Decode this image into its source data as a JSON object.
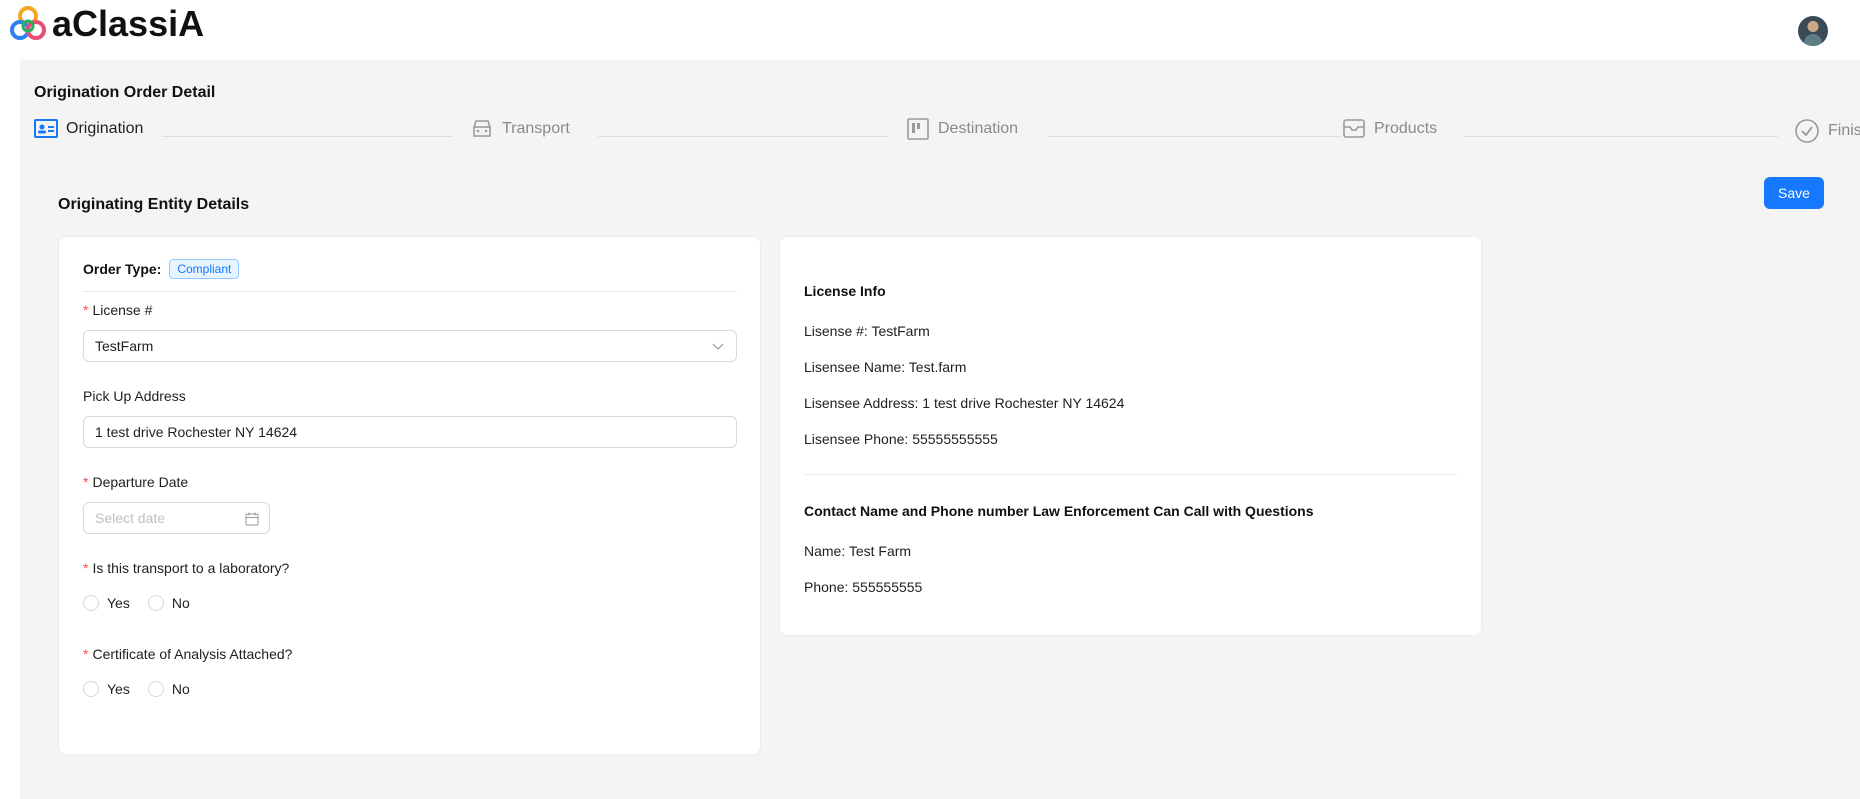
{
  "header": {
    "brand": "aClassiA",
    "logo_icon": "interlocking-rings-logo",
    "avatar_icon": "user-avatar"
  },
  "page": {
    "title": "Origination Order Detail",
    "section_title": "Originating Entity Details",
    "save_label": "Save"
  },
  "steps": [
    {
      "label": "Origination",
      "icon": "id-card-icon",
      "active": true
    },
    {
      "label": "Transport",
      "icon": "truck-icon",
      "active": false
    },
    {
      "label": "Destination",
      "icon": "board-icon",
      "active": false
    },
    {
      "label": "Products",
      "icon": "inbox-icon",
      "active": false
    },
    {
      "label": "Finish",
      "icon": "check-circle-icon",
      "active": false
    }
  ],
  "form": {
    "order_type_label": "Order Type:",
    "order_type_value": "Compliant",
    "license_label": "License #",
    "license_value": "TestFarm",
    "pickup_label": "Pick Up Address",
    "pickup_value": "1 test drive Rochester NY 14624",
    "departure_label": "Departure Date",
    "departure_placeholder": "Select date",
    "lab_question": "Is this transport to a laboratory?",
    "coa_question": "Certificate of Analysis Attached?",
    "yes_label": "Yes",
    "no_label": "No"
  },
  "license_info": {
    "title": "License Info",
    "license_line": "Lisense #: TestFarm",
    "name_line": "Lisensee Name: Test.farm",
    "address_line": "Lisensee Address: 1 test drive Rochester NY 14624",
    "phone_line": "Lisensee Phone: 55555555555",
    "contact_title": "Contact Name and Phone number Law Enforcement Can Call with Questions",
    "contact_name_line": "Name: Test Farm",
    "contact_phone_line": "Phone: 555555555"
  },
  "colors": {
    "accent": "#1677ff",
    "required": "#ff4d4f",
    "background": "#f4f4f4"
  }
}
